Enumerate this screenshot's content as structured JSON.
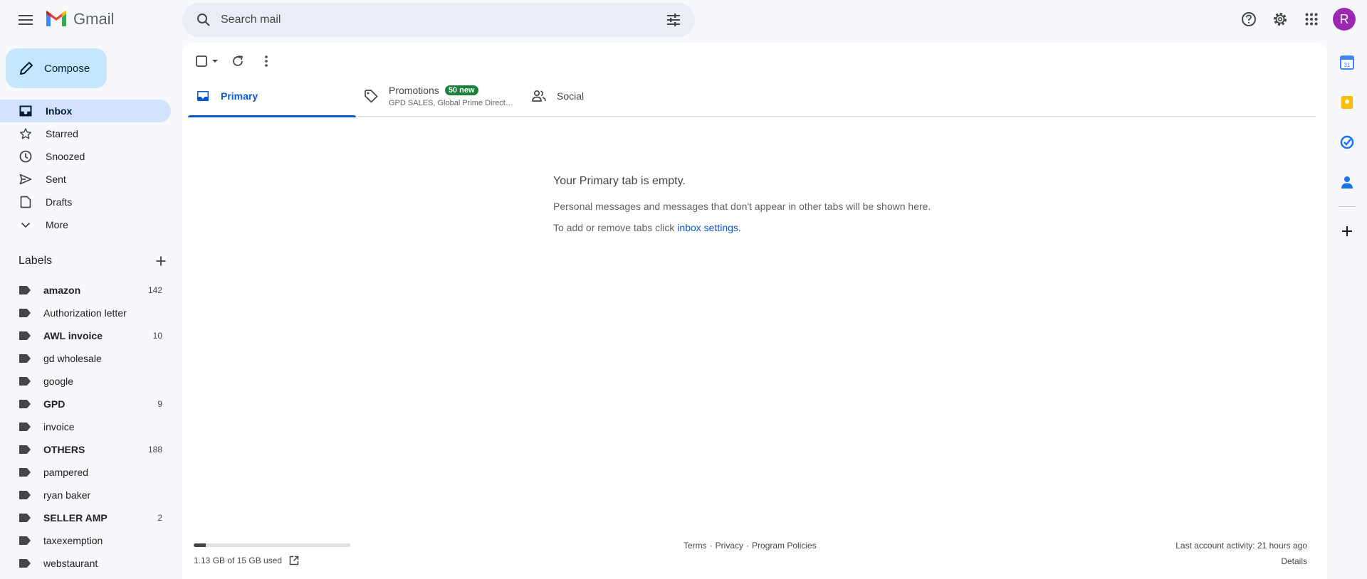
{
  "app": {
    "name": "Gmail",
    "avatar_letter": "R",
    "avatar_color": "#9c27b0"
  },
  "search": {
    "placeholder": "Search mail"
  },
  "compose": {
    "label": "Compose"
  },
  "nav": [
    {
      "label": "Inbox",
      "icon": "inbox-icon",
      "active": true
    },
    {
      "label": "Starred",
      "icon": "star-icon"
    },
    {
      "label": "Snoozed",
      "icon": "clock-icon"
    },
    {
      "label": "Sent",
      "icon": "send-icon"
    },
    {
      "label": "Drafts",
      "icon": "draft-icon"
    },
    {
      "label": "More",
      "icon": "chevron-down-icon"
    }
  ],
  "labels": {
    "title": "Labels",
    "items": [
      {
        "name": "amazon",
        "count": "142",
        "bold": true
      },
      {
        "name": "Authorization letter",
        "count": "",
        "bold": false
      },
      {
        "name": "AWL invoice",
        "count": "10",
        "bold": true
      },
      {
        "name": "gd wholesale",
        "count": "",
        "bold": false
      },
      {
        "name": "google",
        "count": "",
        "bold": false
      },
      {
        "name": "GPD",
        "count": "9",
        "bold": true
      },
      {
        "name": "invoice",
        "count": "",
        "bold": false
      },
      {
        "name": "OTHERS",
        "count": "188",
        "bold": true
      },
      {
        "name": "pampered",
        "count": "",
        "bold": false
      },
      {
        "name": "ryan baker",
        "count": "",
        "bold": false
      },
      {
        "name": "SELLER AMP",
        "count": "2",
        "bold": true
      },
      {
        "name": "taxexemption",
        "count": "",
        "bold": false
      },
      {
        "name": "webstaurant",
        "count": "",
        "bold": false
      }
    ]
  },
  "tabs": {
    "primary": "Primary",
    "promotions": "Promotions",
    "promotions_badge": "50 new",
    "promotions_sub": "GPD SALES, Global Prime Direct…",
    "social": "Social"
  },
  "empty": {
    "title": "Your Primary tab is empty.",
    "line1": "Personal messages and messages that don't appear in other tabs will be shown here.",
    "line2_prefix": "To add or remove tabs click ",
    "line2_link": "inbox settings",
    "line2_suffix": "."
  },
  "footer": {
    "storage_text": "1.13 GB of 15 GB used",
    "storage_fraction": 0.075,
    "terms": "Terms",
    "privacy": "Privacy",
    "program_policies": "Program Policies",
    "separator": "·",
    "last_activity": "Last account activity: 21 hours ago",
    "details": "Details"
  },
  "colors": {
    "accent": "#0b57d0",
    "compose_bg": "#c2e7ff",
    "active_nav": "#d3e3fd",
    "badge": "#188038"
  }
}
